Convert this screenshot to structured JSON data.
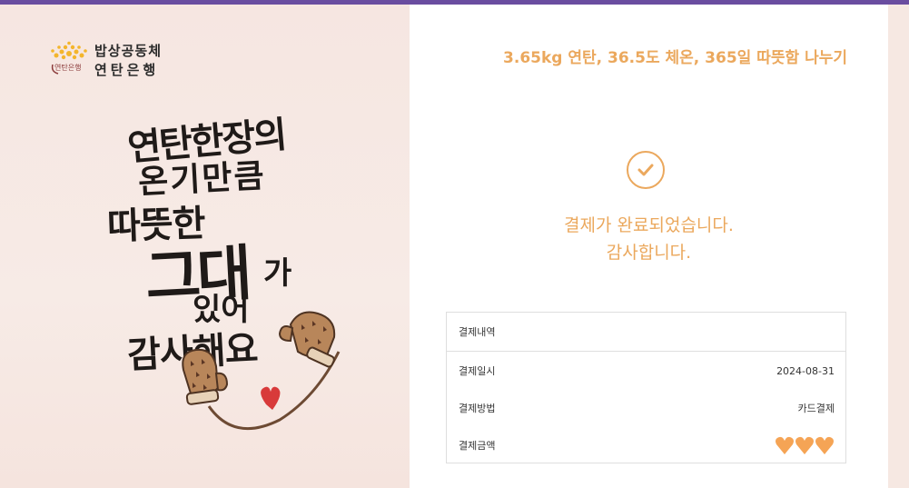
{
  "brand": {
    "line1": "밥상공동체",
    "line2": "연탄은행",
    "sub": "연탄은행",
    "sun_color": "#f3b52c"
  },
  "promo": {
    "lines": [
      "연탄한장의",
      "온기만큼",
      "따뜻한",
      "그대",
      "가",
      "있어",
      "감사해요"
    ],
    "heart_color": "#d83a3a",
    "mitten_color": "#b8865a"
  },
  "card": {
    "tagline": "3.65kg 연탄, 36.5도 체온, 365일 따뜻함 나누기",
    "success_icon": "check-circle-icon",
    "message_line1": "결제가 완료되었습니다.",
    "message_line2": "감사합니다.",
    "accent": "#eba85d"
  },
  "payment": {
    "title": "결제내역",
    "rows": [
      {
        "label": "결제일시",
        "value": "2024-08-31"
      },
      {
        "label": "결제방법",
        "value": "카드결제"
      },
      {
        "label": "결제금액",
        "value": ""
      }
    ],
    "amount_icon": "heart-icon",
    "amount_color": "#f5a455"
  },
  "topbar_color": "#6a4da0"
}
